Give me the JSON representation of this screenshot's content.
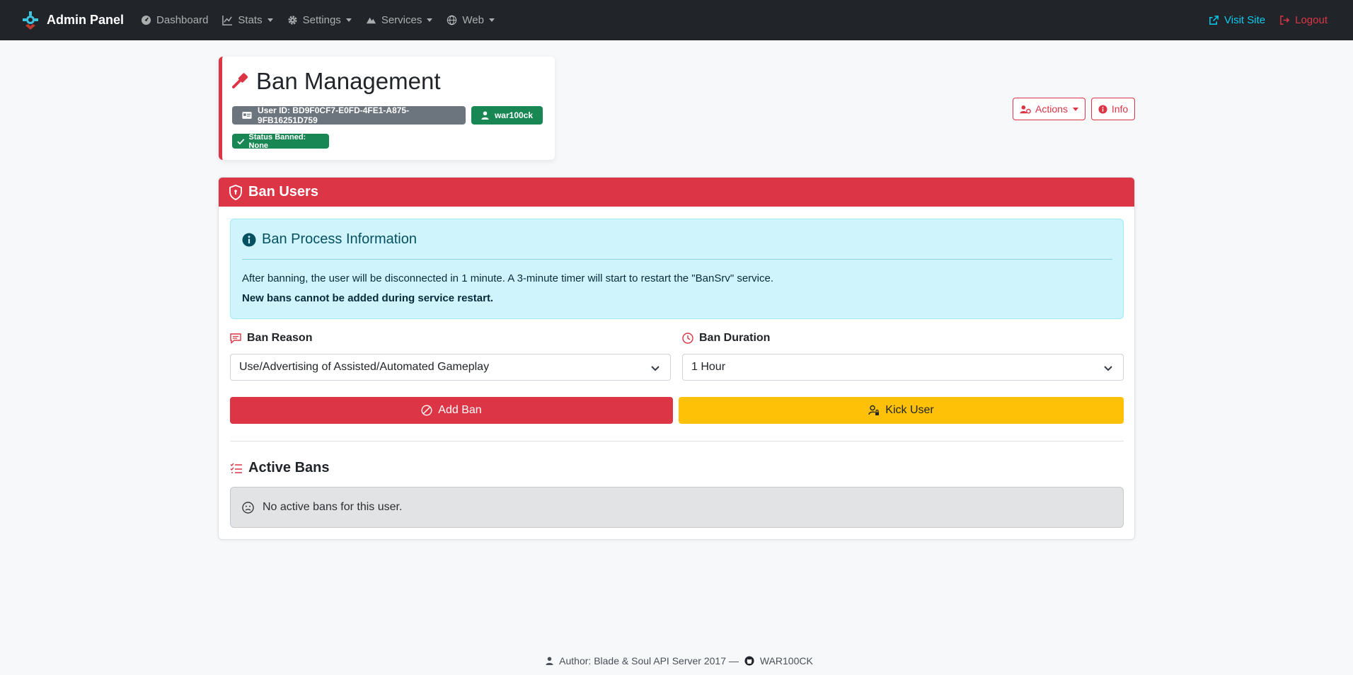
{
  "navbar": {
    "brand": "Admin Panel",
    "items": [
      {
        "label": "Dashboard",
        "icon": "dashboard-icon",
        "dropdown": false
      },
      {
        "label": "Stats",
        "icon": "chart-line-icon",
        "dropdown": true
      },
      {
        "label": "Settings",
        "icon": "gear-icon",
        "dropdown": true
      },
      {
        "label": "Services",
        "icon": "mountain-icon",
        "dropdown": true
      },
      {
        "label": "Web",
        "icon": "globe-icon",
        "dropdown": true
      }
    ],
    "visit_site": "Visit Site",
    "logout": "Logout"
  },
  "header": {
    "title": "Ban Management",
    "user_id": "User ID: BD9F0CF7-E0FD-4FE1-A875-9FB16251D759",
    "username": "war100ck",
    "status": "Status Banned: None",
    "actions_label": "Actions",
    "info_label": "Info"
  },
  "ban_card": {
    "title": "Ban Users",
    "info": {
      "title": "Ban Process Information",
      "line1": "After banning, the user will be disconnected in 1 minute. A 3-minute timer will start to restart the \"BanSrv\" service.",
      "line2": "New bans cannot be added during service restart."
    },
    "reason_label": "Ban Reason",
    "reason_value": "Use/Advertising of Assisted/Automated Gameplay",
    "duration_label": "Ban Duration",
    "duration_value": "1 Hour",
    "add_ban_label": "Add Ban",
    "kick_user_label": "Kick User",
    "active_bans_title": "Active Bans",
    "no_bans_text": "No active bans for this user."
  },
  "footer": {
    "text": "Author: Blade & Soul API Server 2017 —",
    "github": "WAR100CK"
  },
  "colors": {
    "navbar": "#212529",
    "danger": "#dc3545",
    "success": "#198754",
    "secondary": "#6c757d",
    "warning": "#ffc107",
    "info_bg": "#cff4fc",
    "link_info": "#0dcaf0"
  }
}
